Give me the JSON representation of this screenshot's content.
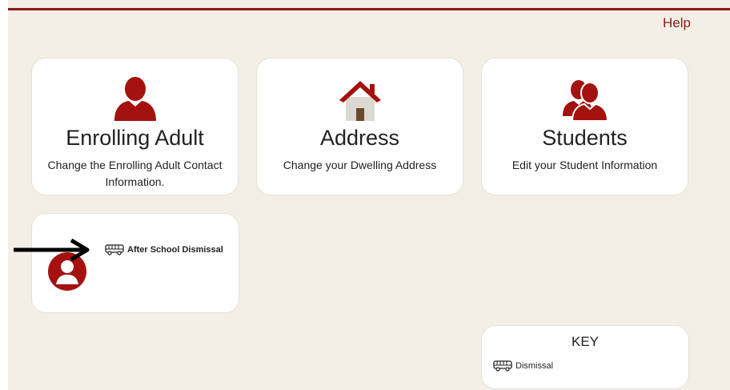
{
  "header": {
    "help_label": "Help"
  },
  "tiles": [
    {
      "title": "Enrolling Adult",
      "description": "Change the Enrolling Adult Contact Information.",
      "icon": "person-icon"
    },
    {
      "title": "Address",
      "description": "Change your Dwelling Address",
      "icon": "house-icon"
    },
    {
      "title": "Students",
      "description": "Edit your Student Information",
      "icon": "people-icon"
    }
  ],
  "student_card": {
    "link_label": "After School Dismissal",
    "link_icon": "bus-icon",
    "avatar_icon": "student-avatar-icon"
  },
  "key": {
    "title": "KEY",
    "items": [
      {
        "icon": "bus-icon",
        "label": "Dismissal"
      }
    ]
  },
  "colors": {
    "accent": "#8b1a1a",
    "background": "#f3efe6",
    "card": "#ffffff"
  }
}
